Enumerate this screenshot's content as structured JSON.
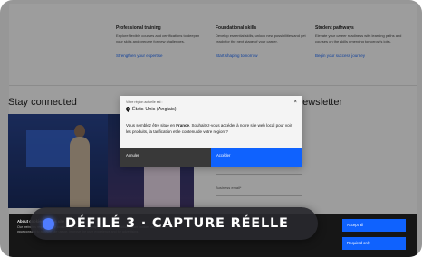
{
  "columns": [
    {
      "title": "Professional training",
      "body": "Explore flexible courses and certifications to deepen your skills and prepare for new challenges.",
      "link": "Strengthen your expertise"
    },
    {
      "title": "Foundational skills",
      "body": "Develop essential skills, unlock new possibilities and get ready for the next stage of your career.",
      "link": "Start shaping tomorrow"
    },
    {
      "title": "Student pathways",
      "body": "Elevate your career readiness with learning paths and courses on the skills emerging tomorrow's jobs.",
      "link": "Begin your success journey"
    }
  ],
  "sections": {
    "stay_connected": "Stay connected",
    "newsletter": "newsletter",
    "email_label": "Business email*"
  },
  "modal": {
    "small_label": "Votre région actuelle est :",
    "region": "États-Unis (Anglais)",
    "message_pre": "Vous semblez être situé en ",
    "country": "France",
    "message_post": ". Souhaitez-vous accéder à notre site web local pour voir les produits, la tarification et le contenu de votre région ?",
    "decline": "Annuler",
    "accept": "Accéder",
    "close": "×"
  },
  "cookie": {
    "title": "About cookies on this site",
    "text": "Our websites require some cookies to function properly (required). In addition, other cookies may be used with your consent to analyze site usage, improve the user experience and for advertising.",
    "accept_all": "Accept all",
    "required_only": "Required only"
  },
  "caption": "DÉFILÉ 3 · CAPTURE RÉELLE",
  "colors": {
    "accent": "#0f62fe",
    "pill_dot": "#4f7cff",
    "pill_bg": "#28282e"
  }
}
